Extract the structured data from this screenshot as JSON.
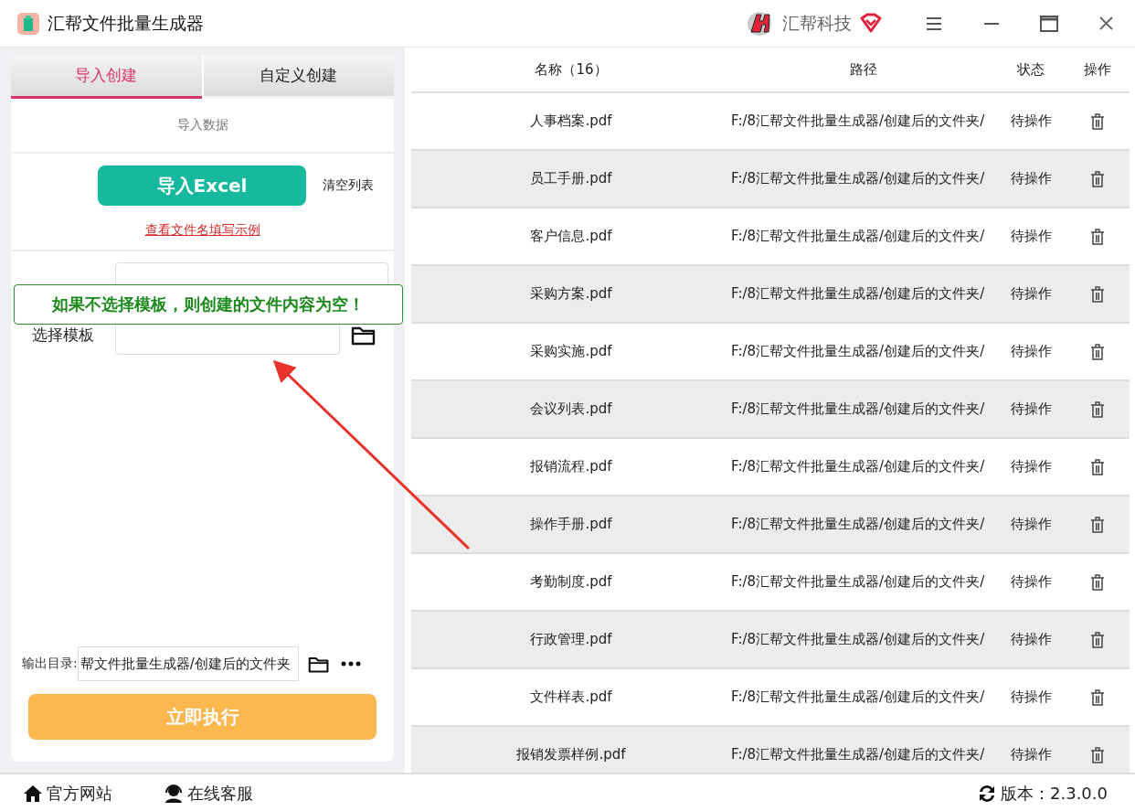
{
  "window": {
    "title": "汇帮文件批量生成器",
    "brand": "汇帮科技"
  },
  "tabs": [
    {
      "label": "导入创建",
      "selected": true
    },
    {
      "label": "自定义创建",
      "selected": false
    }
  ],
  "import": {
    "section_label": "导入数据",
    "import_button": "导入Excel",
    "clear_button": "清空列表",
    "example_link": "查看文件名填写示例"
  },
  "template": {
    "label": "选择模板"
  },
  "callout": "如果不选择模板，则创建的文件内容为空！",
  "output": {
    "label": "输出目录:",
    "value": "帮文件批量生成器/创建后的文件夹"
  },
  "run_button": "立即执行",
  "table": {
    "columns": [
      "名称（16）",
      "路径",
      "状态",
      "操作"
    ],
    "rows": [
      {
        "name": "人事档案.pdf",
        "path": "F:/8汇帮文件批量生成器/创建后的文件夹/",
        "status": "待操作"
      },
      {
        "name": "员工手册.pdf",
        "path": "F:/8汇帮文件批量生成器/创建后的文件夹/",
        "status": "待操作"
      },
      {
        "name": "客户信息.pdf",
        "path": "F:/8汇帮文件批量生成器/创建后的文件夹/",
        "status": "待操作"
      },
      {
        "name": "采购方案.pdf",
        "path": "F:/8汇帮文件批量生成器/创建后的文件夹/",
        "status": "待操作"
      },
      {
        "name": "采购实施.pdf",
        "path": "F:/8汇帮文件批量生成器/创建后的文件夹/",
        "status": "待操作"
      },
      {
        "name": "会议列表.pdf",
        "path": "F:/8汇帮文件批量生成器/创建后的文件夹/",
        "status": "待操作"
      },
      {
        "name": "报销流程.pdf",
        "path": "F:/8汇帮文件批量生成器/创建后的文件夹/",
        "status": "待操作"
      },
      {
        "name": "操作手册.pdf",
        "path": "F:/8汇帮文件批量生成器/创建后的文件夹/",
        "status": "待操作"
      },
      {
        "name": "考勤制度.pdf",
        "path": "F:/8汇帮文件批量生成器/创建后的文件夹/",
        "status": "待操作"
      },
      {
        "name": "行政管理.pdf",
        "path": "F:/8汇帮文件批量生成器/创建后的文件夹/",
        "status": "待操作"
      },
      {
        "name": "文件样表.pdf",
        "path": "F:/8汇帮文件批量生成器/创建后的文件夹/",
        "status": "待操作"
      },
      {
        "name": "报销发票样例.pdf",
        "path": "F:/8汇帮文件批量生成器/创建后的文件夹/",
        "status": "待操作"
      }
    ]
  },
  "footer": {
    "links": [
      "官方网站",
      "在线客服"
    ],
    "version": "版本：2.3.0.0"
  }
}
